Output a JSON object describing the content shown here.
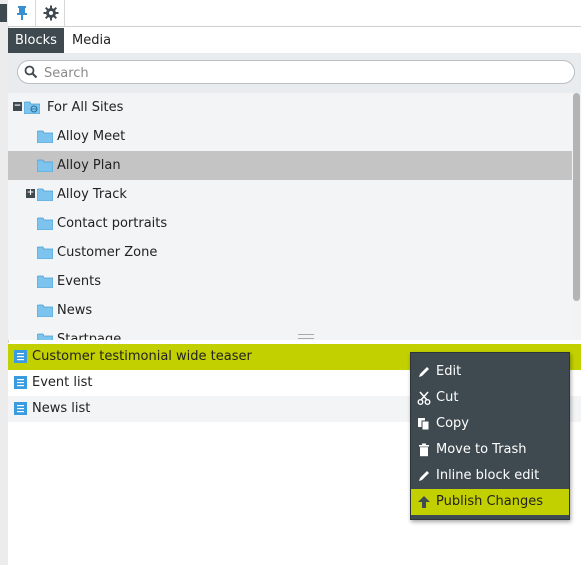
{
  "icons": {
    "pin": "pin-icon",
    "settings": "gear-icon",
    "search": "search-icon",
    "folder": "folder-icon",
    "expand": "plus-toggle-icon",
    "collapse": "minus-toggle-icon",
    "block": "block-icon",
    "edit": "pencil-icon",
    "cut": "scissors-icon",
    "copy": "copy-icon",
    "trash": "trash-icon",
    "publish": "arrow-up-icon",
    "menu": "chevron-down-icon"
  },
  "colors": {
    "accent": "#c3d000",
    "dark": "#3f4a50",
    "selection": "#c4c4c4",
    "folder": "#7cc4ee"
  },
  "tabs": [
    {
      "label": "Blocks",
      "active": true
    },
    {
      "label": "Media",
      "active": false
    }
  ],
  "search": {
    "placeholder": "Search",
    "value": ""
  },
  "tree": {
    "root": {
      "label": "For All Sites",
      "expanded": true
    },
    "items": [
      {
        "label": "Alloy Meet",
        "selected": false,
        "expandable": false
      },
      {
        "label": "Alloy Plan",
        "selected": true,
        "expandable": false
      },
      {
        "label": "Alloy Track",
        "selected": false,
        "expandable": true
      },
      {
        "label": "Contact portraits",
        "selected": false,
        "expandable": false
      },
      {
        "label": "Customer Zone",
        "selected": false,
        "expandable": false
      },
      {
        "label": "Events",
        "selected": false,
        "expandable": false
      },
      {
        "label": "News",
        "selected": false,
        "expandable": false
      },
      {
        "label": "Startpage",
        "selected": false,
        "expandable": false
      }
    ]
  },
  "blocks": [
    {
      "label": "Customer testimonial wide teaser",
      "highlighted": true
    },
    {
      "label": "Event list",
      "highlighted": false
    },
    {
      "label": "News list",
      "highlighted": false
    }
  ],
  "context_menu": {
    "items": [
      {
        "label": "Edit",
        "icon": "pencil-icon",
        "active": false
      },
      {
        "label": "Cut",
        "icon": "scissors-icon",
        "active": false
      },
      {
        "label": "Copy",
        "icon": "copy-icon",
        "active": false
      },
      {
        "label": "Move to Trash",
        "icon": "trash-icon",
        "active": false
      },
      {
        "label": "Inline block edit",
        "icon": "pencil-icon",
        "active": false
      },
      {
        "label": "Publish Changes",
        "icon": "arrow-up-icon",
        "active": true
      }
    ]
  }
}
